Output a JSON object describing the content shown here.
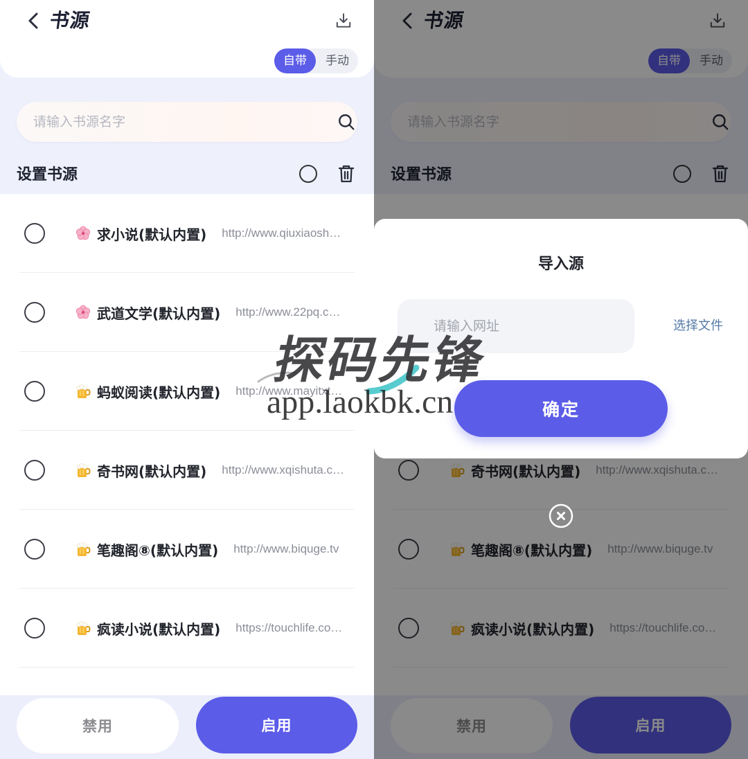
{
  "colors": {
    "accent": "#5b5ce8",
    "background": "#eef0fc",
    "url_text": "#8b8e98",
    "link": "#5479a6"
  },
  "header": {
    "title": "书源",
    "back_icon": "back-chevron-icon",
    "download_icon": "download-icon"
  },
  "source_mode_toggle": {
    "options": [
      {
        "label": "自带",
        "selected": true
      },
      {
        "label": "手动",
        "selected": false
      }
    ]
  },
  "search": {
    "placeholder": "请输入书源名字",
    "icon": "search-icon"
  },
  "section": {
    "title": "设置书源",
    "select_all_checked": false,
    "delete_icon": "trash-icon"
  },
  "sources": [
    {
      "icon": "cherry-blossom-icon",
      "name": "求小说(默认内置)",
      "url": "http://www.qiuxiaosh…",
      "checked": false
    },
    {
      "icon": "cherry-blossom-icon",
      "name": "武道文学(默认内置)",
      "url": "http://www.22pq.c…",
      "checked": false
    },
    {
      "icon": "beer-mug-icon",
      "name": "蚂蚁阅读(默认内置)",
      "url": "http://www.mayitxt…",
      "checked": false
    },
    {
      "icon": "beer-mug-icon",
      "name": "奇书网(默认内置)",
      "url": "http://www.xqishuta.c…",
      "checked": false
    },
    {
      "icon": "beer-mug-icon",
      "name": "笔趣阁⑧(默认内置)",
      "url": "http://www.biquge.tv",
      "checked": false
    },
    {
      "icon": "beer-mug-icon",
      "name": "疯读小说(默认内置)",
      "url": "https://touchlife.co…",
      "checked": false
    }
  ],
  "actions": {
    "disable_label": "禁用",
    "enable_label": "启用"
  },
  "import_dialog": {
    "title": "导入源",
    "url_placeholder": "请输入网址",
    "choose_file": "选择文件",
    "confirm": "确定",
    "close_icon": "close-icon"
  },
  "watermark": {
    "brand": "探码先锋",
    "site": "app.laokbk.cn"
  }
}
